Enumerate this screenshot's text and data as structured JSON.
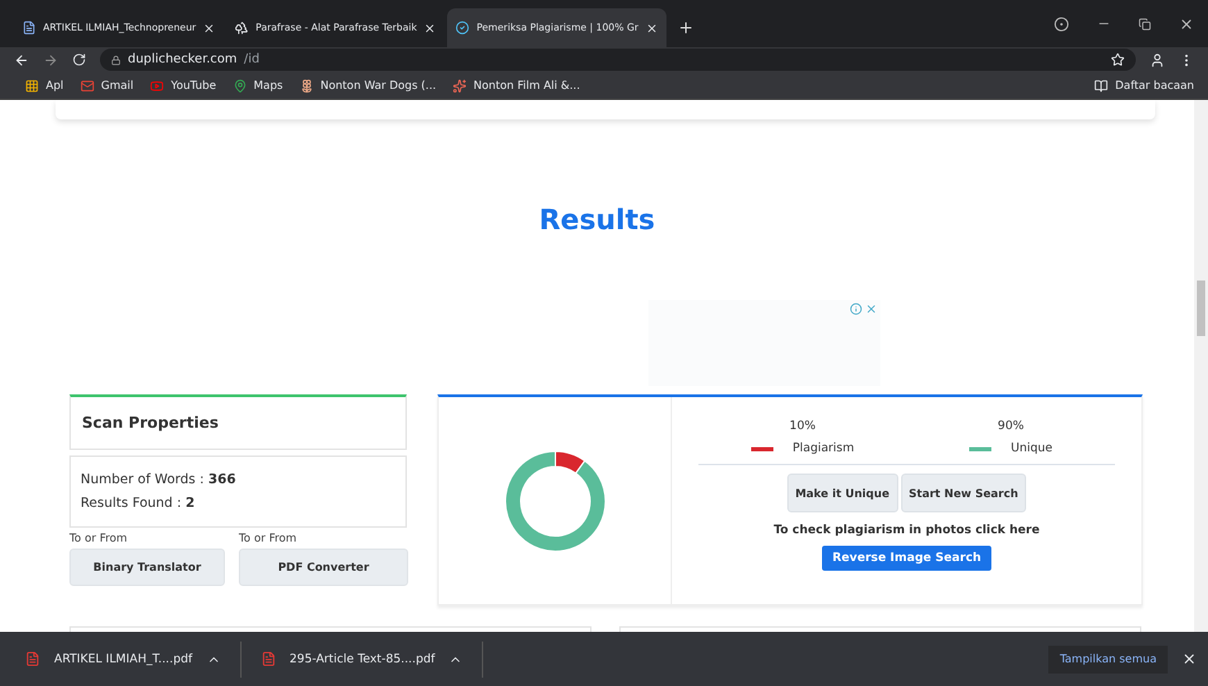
{
  "browser": {
    "tabs": [
      {
        "title": "ARTIKEL ILMIAH_Technopreneur",
        "selected": false,
        "kind": "doc"
      },
      {
        "title": "Parafrase - Alat Parafrase Terbaik",
        "selected": false,
        "kind": "tree"
      },
      {
        "title": "Pemeriksa Plagiarisme | 100% Gr",
        "selected": true,
        "kind": "check"
      }
    ],
    "url_host": "duplichecker.com",
    "url_path": "/id",
    "bookmarks": [
      {
        "label": "Apl",
        "kind": "apps"
      },
      {
        "label": "Gmail",
        "kind": "mail"
      },
      {
        "label": "YouTube",
        "kind": "video"
      },
      {
        "label": "Maps",
        "kind": "pin"
      },
      {
        "label": "Nonton War Dogs (...",
        "kind": "flower"
      },
      {
        "label": "Nonton Film Ali &...",
        "kind": "star"
      }
    ],
    "reading_list": "Daftar bacaan"
  },
  "page": {
    "heading": "Results",
    "scan_title": "Scan Properties",
    "stats": [
      {
        "label": "Number of Words :",
        "value": "366"
      },
      {
        "label": "Results Found :",
        "value": "2"
      }
    ],
    "tools": [
      {
        "caption": "To or From",
        "button": "Binary Translator"
      },
      {
        "caption": "To or From",
        "button": "PDF Converter"
      }
    ],
    "chart_data": {
      "type": "donut",
      "categories": [
        "Plagiarism",
        "Unique"
      ],
      "values": [
        10,
        90
      ]
    },
    "legend": [
      {
        "percent": "10%",
        "color": "#d9272e"
      },
      {
        "percent": "90%",
        "color": "#5abd9a"
      }
    ],
    "actions": [
      "Make it Unique",
      "Start New Search"
    ],
    "photo_note": "To check plagiarism in photos click here",
    "reverse_button": "Reverse Image Search"
  },
  "downloads": {
    "items": [
      "ARTIKEL ILMIAH_T....pdf",
      "295-Article Text-85....pdf"
    ],
    "show_all": "Tampilkan semua"
  }
}
